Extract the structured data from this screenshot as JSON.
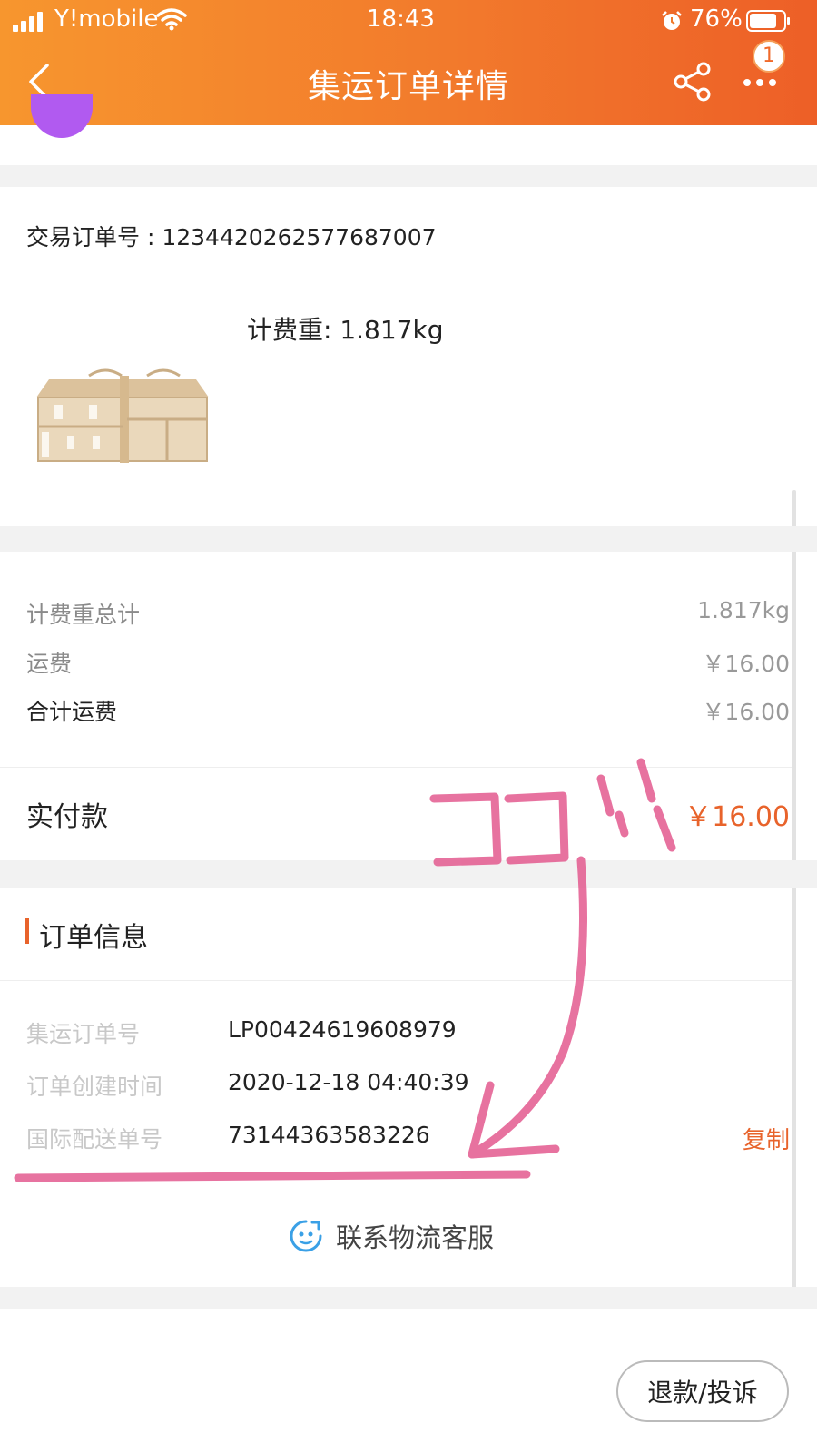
{
  "status_bar": {
    "carrier": "Y!mobile",
    "time": "18:43",
    "battery": "76%"
  },
  "header": {
    "title": "集运订单详情",
    "badge": "1",
    "icons": [
      "back-icon",
      "share-icon",
      "more-icon"
    ]
  },
  "order": {
    "trade_order_no": "交易订单号 : 1234420262577687007",
    "chargeable_weight": "计费重: 1.817kg"
  },
  "fees": {
    "rows": [
      {
        "label": "计费重总计",
        "value": "1.817kg"
      },
      {
        "label": "运费",
        "value": "￥16.00"
      },
      {
        "label": "合计运费",
        "value": "￥16.00"
      }
    ],
    "paid_label": "实付款",
    "paid_value": "￥16.00"
  },
  "order_info": {
    "section_title": "订单信息",
    "rows": [
      {
        "label": "集运订单号",
        "value": "LP00424619608979"
      },
      {
        "label": "订单创建时间",
        "value": "2020-12-18 04:40:39"
      },
      {
        "label": "国际配送单号",
        "value": "73144363583226"
      }
    ],
    "copy_label": "复制"
  },
  "contact": {
    "label": "联系物流客服"
  },
  "footer": {
    "refund_button": "退款/投诉"
  },
  "colors": {
    "accent": "#e8632b",
    "header_start": "#f7962e",
    "header_end": "#ed5f27",
    "annotation": "#e35a8f",
    "contact_icon": "#3aa0e6"
  }
}
